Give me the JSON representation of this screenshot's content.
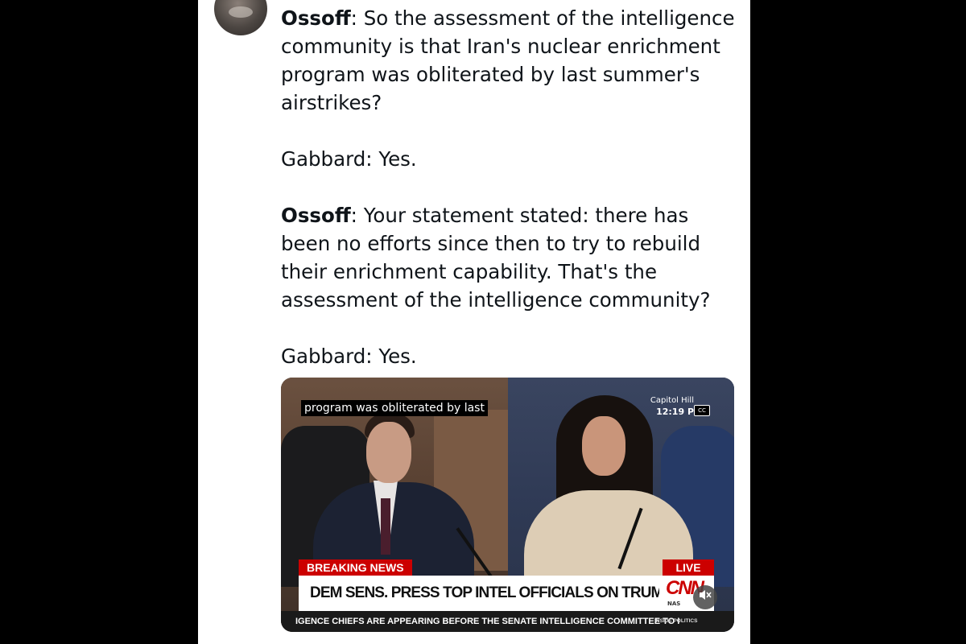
{
  "post": {
    "paragraphs": [
      {
        "speaker": "Ossoff",
        "text": ": So the assessment of the intelligence community is that Iran's nuclear enrichment program was obliterated by last summer's airstrikes?"
      },
      {
        "speaker": "",
        "text": "Gabbard: Yes."
      },
      {
        "speaker": "Ossoff",
        "text": ": Your statement stated: there has been no efforts since then to try to rebuild their enrichment capability. That's the assessment of the intelligence community?"
      },
      {
        "speaker": "",
        "text": "Gabbard: Yes."
      }
    ]
  },
  "video": {
    "caption": "program was obliterated by last",
    "source_label": "Capitol Hill",
    "time": "12:19 P",
    "cc_label": "CC",
    "breaking_label": "BREAKING NEWS",
    "live_label": "LIVE",
    "headline": "DEM SENS. PRESS TOP INTEL OFFICIALS ON TRUMP FUNDRAISING EMAIL",
    "network_logo": "CNN",
    "market_label": "NAS",
    "ticker": "IGENCE CHIEFS ARE APPEARING BEFORE THE SENATE INTELLIGENCE COMMITTEE TO I",
    "ticker_segment": "INSIDE POLITICS",
    "mute_icon": "speaker-muted-icon"
  },
  "colors": {
    "cnn_red": "#cc0000",
    "text": "#0f1419",
    "page_background": "#000000"
  }
}
